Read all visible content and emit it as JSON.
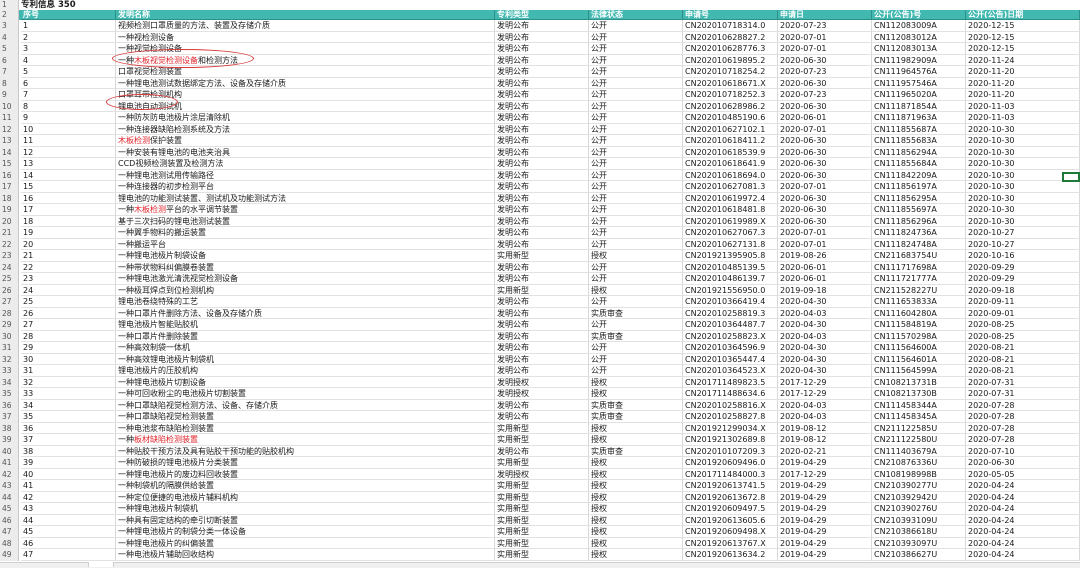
{
  "title": "专利信息 350",
  "headers": [
    "序号",
    "发明名称",
    "专利类型",
    "法律状态",
    "申请号",
    "申请日",
    "公开(公告)号",
    "公开(公告)日期"
  ],
  "rows": [
    [
      "1",
      "视频检测口罩质量的方法、装置及存储介质",
      "发明公布",
      "公开",
      "CN202010718314.0",
      "2020-07-23",
      "CN112083009A",
      "2020-12-15"
    ],
    [
      "2",
      "一种视检测设备",
      "发明公布",
      "公开",
      "CN202010628827.2",
      "2020-07-01",
      "CN112083012A",
      "2020-12-15"
    ],
    [
      "3",
      "一种视觉检测设备",
      "发明公布",
      "公开",
      "CN202010628776.3",
      "2020-07-01",
      "CN112083013A",
      "2020-12-15"
    ],
    [
      "4",
      "一种木板视觉检测设备和检测方法",
      "发明公布",
      "公开",
      "CN202010619895.2",
      "2020-06-30",
      "CN111982909A",
      "2020-11-24"
    ],
    [
      "5",
      "口罩视觉检测装置",
      "发明公布",
      "公开",
      "CN202010718254.2",
      "2020-07-23",
      "CN111964576A",
      "2020-11-20"
    ],
    [
      "6",
      "一种锂电池测试数据绑定方法、设备及存储介质",
      "发明公布",
      "公开",
      "CN202010618671.X",
      "2020-06-30",
      "CN111957546A",
      "2020-11-20"
    ],
    [
      "7",
      "口罩耳带检测机构",
      "发明公布",
      "公开",
      "CN202010718252.3",
      "2020-07-23",
      "CN111965020A",
      "2020-11-20"
    ],
    [
      "8",
      "锂电池自动测试机",
      "发明公布",
      "公开",
      "CN202010628986.2",
      "2020-06-30",
      "CN111871854A",
      "2020-11-03"
    ],
    [
      "9",
      "一种防灰防电池极片涂层清除机",
      "发明公布",
      "公开",
      "CN202010485190.6",
      "2020-06-01",
      "CN111871963A",
      "2020-11-03"
    ],
    [
      "10",
      "一种连接器缺陷检测系统及方法",
      "发明公布",
      "公开",
      "CN202010627102.1",
      "2020-07-01",
      "CN111855687A",
      "2020-10-30"
    ],
    [
      "11",
      "木板检测保护装置",
      "发明公布",
      "公开",
      "CN202010618411.2",
      "2020-06-30",
      "CN111855683A",
      "2020-10-30"
    ],
    [
      "12",
      "一种安装有锂电池的电池夹治具",
      "发明公布",
      "公开",
      "CN202010618539.9",
      "2020-06-30",
      "CN111856294A",
      "2020-10-30"
    ],
    [
      "13",
      "CCD视频检测装置及检测方法",
      "发明公布",
      "公开",
      "CN202010618641.9",
      "2020-06-30",
      "CN111855684A",
      "2020-10-30"
    ],
    [
      "14",
      "一种锂电池测试用传输路径",
      "发明公布",
      "公开",
      "CN202010618694.0",
      "2020-06-30",
      "CN111842209A",
      "2020-10-30"
    ],
    [
      "15",
      "一种连接器的初步检测平台",
      "发明公布",
      "公开",
      "CN202010627081.3",
      "2020-07-01",
      "CN111856197A",
      "2020-10-30"
    ],
    [
      "16",
      "锂电池的功能测试装置、测试机及功能测试方法",
      "发明公布",
      "公开",
      "CN202010619972.4",
      "2020-06-30",
      "CN111856295A",
      "2020-10-30"
    ],
    [
      "17",
      "一种木板检测平台的水平调节装置",
      "发明公布",
      "公开",
      "CN202010618481.8",
      "2020-06-30",
      "CN111855697A",
      "2020-10-30"
    ],
    [
      "18",
      "基于三次扫码的锂电池测试装置",
      "发明公布",
      "公开",
      "CN202010619989.X",
      "2020-06-30",
      "CN111856296A",
      "2020-10-30"
    ],
    [
      "19",
      "一种翼手物料的搬运装置",
      "发明公布",
      "公开",
      "CN202010627067.3",
      "2020-07-01",
      "CN111824736A",
      "2020-10-27"
    ],
    [
      "20",
      "一种搬运平台",
      "发明公布",
      "公开",
      "CN202010627131.8",
      "2020-07-01",
      "CN111824748A",
      "2020-10-27"
    ],
    [
      "21",
      "一种锂电池极片制袋设备",
      "实用新型",
      "授权",
      "CN201921395905.8",
      "2019-08-26",
      "CN211683754U",
      "2020-10-16"
    ],
    [
      "22",
      "一种带状物料纠偏膜卷装置",
      "发明公布",
      "公开",
      "CN202010485139.5",
      "2020-06-01",
      "CN111717698A",
      "2020-09-29"
    ],
    [
      "23",
      "一种锂电池激光清洗视觉检测设备",
      "发明公布",
      "公开",
      "CN202010486139.7",
      "2020-06-01",
      "CN111721777A",
      "2020-09-29"
    ],
    [
      "24",
      "一种极耳焊点到位检测机构",
      "实用新型",
      "授权",
      "CN201921556950.0",
      "2019-09-18",
      "CN211528227U",
      "2020-09-18"
    ],
    [
      "25",
      "锂电池卷绕特殊的工艺",
      "发明公布",
      "公开",
      "CN202010366419.4",
      "2020-04-30",
      "CN111653833A",
      "2020-09-11"
    ],
    [
      "26",
      "一种口罩片件删除方法、设备及存储介质",
      "发明公布",
      "实质审查",
      "CN202010258819.3",
      "2020-04-03",
      "CN111604280A",
      "2020-09-01"
    ],
    [
      "27",
      "锂电池极片智能贴胶机",
      "发明公布",
      "公开",
      "CN202010364487.7",
      "2020-04-30",
      "CN111584819A",
      "2020-08-25"
    ],
    [
      "28",
      "一种口罩片件删除装置",
      "发明公布",
      "实质审查",
      "CN202010258823.X",
      "2020-04-03",
      "CN111570298A",
      "2020-08-25"
    ],
    [
      "29",
      "一种高效制袋一体机",
      "发明公布",
      "公开",
      "CN202010364596.9",
      "2020-04-30",
      "CN111564600A",
      "2020-08-21"
    ],
    [
      "30",
      "一种高效锂电池极片制袋机",
      "发明公布",
      "公开",
      "CN202010365447.4",
      "2020-04-30",
      "CN111564601A",
      "2020-08-21"
    ],
    [
      "31",
      "锂电池极片的压胶机构",
      "发明公布",
      "公开",
      "CN202010364523.X",
      "2020-04-30",
      "CN111564599A",
      "2020-08-21"
    ],
    [
      "32",
      "一种锂电池极片切割设备",
      "发明授权",
      "授权",
      "CN201711489823.5",
      "2017-12-29",
      "CN108213731B",
      "2020-07-31"
    ],
    [
      "33",
      "一种可回收粉尘的电池极片切割装置",
      "发明授权",
      "授权",
      "CN201711488634.6",
      "2017-12-29",
      "CN108213730B",
      "2020-07-31"
    ],
    [
      "34",
      "一种口罩缺陷视觉检测方法、设备、存储介质",
      "发明公布",
      "实质审查",
      "CN202010258816.X",
      "2020-04-03",
      "CN111458344A",
      "2020-07-28"
    ],
    [
      "35",
      "一种口罩缺陷视觉检测装置",
      "发明公布",
      "实质审查",
      "CN202010258827.8",
      "2020-04-03",
      "CN111458345A",
      "2020-07-28"
    ],
    [
      "36",
      "一种电池浆布缺陷检测装置",
      "实用新型",
      "授权",
      "CN201921299034.X",
      "2019-08-12",
      "CN211122585U",
      "2020-07-28"
    ],
    [
      "37",
      "一种板材缺陷检测装置",
      "实用新型",
      "授权",
      "CN201921302689.8",
      "2019-08-12",
      "CN211122580U",
      "2020-07-28"
    ],
    [
      "38",
      "一种贴胶干预方法及具有贴胶干预功能的贴胶机构",
      "发明公布",
      "实质审查",
      "CN202010107209.3",
      "2020-02-21",
      "CN111403679A",
      "2020-07-10"
    ],
    [
      "39",
      "一种防破损的锂电池极片分类装置",
      "实用新型",
      "授权",
      "CN201920609496.0",
      "2019-04-29",
      "CN210876336U",
      "2020-06-30"
    ],
    [
      "40",
      "一种锂电池极片的废边料回收装置",
      "发明授权",
      "授权",
      "CN201711484000.3",
      "2017-12-29",
      "CN108198998B",
      "2020-05-05"
    ],
    [
      "41",
      "一种制袋机的隔膜供给装置",
      "实用新型",
      "授权",
      "CN201920613741.5",
      "2019-04-29",
      "CN210390277U",
      "2020-04-24"
    ],
    [
      "42",
      "一种定位便捷的电池极片辅料机构",
      "实用新型",
      "授权",
      "CN201920613672.8",
      "2019-04-29",
      "CN210392942U",
      "2020-04-24"
    ],
    [
      "43",
      "一种锂电池极片制袋机",
      "实用新型",
      "授权",
      "CN201920609497.5",
      "2019-04-29",
      "CN210390276U",
      "2020-04-24"
    ],
    [
      "44",
      "一种具有固定结构的牵引切断装置",
      "实用新型",
      "授权",
      "CN201920613605.6",
      "2019-04-29",
      "CN210393109U",
      "2020-04-24"
    ],
    [
      "45",
      "一种锂电池极片的制袋分类一体设备",
      "实用新型",
      "授权",
      "CN201920609498.X",
      "2019-04-29",
      "CN210386618U",
      "2020-04-24"
    ],
    [
      "46",
      "一种锂电池极片的纠偏装置",
      "实用新型",
      "授权",
      "CN201920613767.X",
      "2019-04-29",
      "CN210393097U",
      "2020-04-24"
    ],
    [
      "47",
      "一种电池极片辅助回收结构",
      "实用新型",
      "授权",
      "CN201920613634.2",
      "2019-04-29",
      "CN210386627U",
      "2020-04-24"
    ]
  ]
}
